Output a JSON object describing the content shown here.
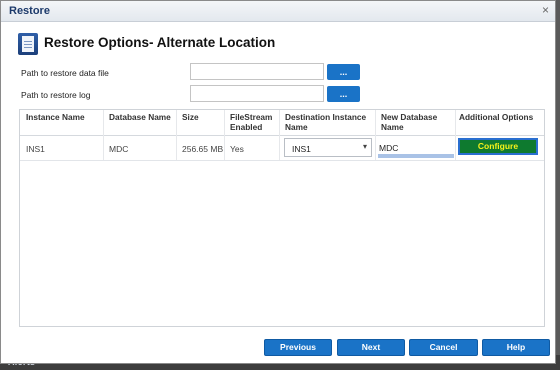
{
  "background": {
    "text": "Alerts"
  },
  "window": {
    "title": "Restore",
    "close_glyph": "×"
  },
  "header": {
    "icon": "document-icon",
    "title": "Restore Options- Alternate Location"
  },
  "form": {
    "data_file_label": "Path to restore data file",
    "data_file_value": "",
    "log_label": "Path to restore log",
    "log_value": "",
    "browse_label": "..."
  },
  "table": {
    "columns": [
      "Instance Name",
      "Database Name",
      "Size",
      "FileStream Enabled",
      "Destination Instance Name",
      "New Database Name",
      "Additional Options"
    ],
    "rows": [
      {
        "instance": "INS1",
        "database": "MDC",
        "size": "256.65 MB",
        "filestream": "Yes",
        "destination": "INS1",
        "new_name": "MDC",
        "action": "Configure"
      }
    ]
  },
  "footer": {
    "previous": "Previous",
    "next": "Next",
    "cancel": "Cancel",
    "help": "Help"
  },
  "colors": {
    "accent": "#1a73c7",
    "configure_bg": "#0e7a2f",
    "configure_text": "#f7f21a",
    "title": "#1d3a6b"
  }
}
